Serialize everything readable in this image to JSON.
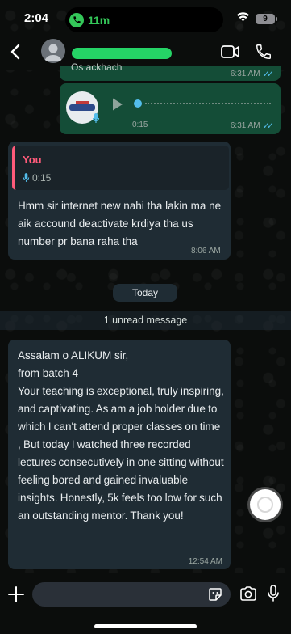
{
  "status_bar": {
    "time": "2:04",
    "call_duration": "11m",
    "battery": "9"
  },
  "header": {
    "contact_name": ""
  },
  "messages": {
    "outgoing_top": {
      "partial_text": "Os ackhach",
      "time": "6:31 AM"
    },
    "voice_note": {
      "duration": "0:15",
      "time": "6:31 AM"
    },
    "reply": {
      "quoted_author": "You",
      "quoted_duration": "0:15",
      "text": "Hmm sir internet new nahi tha lakin ma ne aik accound deactivate krdiya tha us number pr bana raha tha",
      "time": "8:06 AM"
    },
    "date_separator": "Today",
    "unread_banner": "1 unread message",
    "incoming": {
      "text_line1": "Assalam o ALIKUM sir,",
      "text_line2": "from batch 4",
      "text_body": "Your teaching is exceptional, truly inspiring, and captivating. As am a job holder due to which I can't attend proper classes on time , But today I watched three recorded lectures consecutively  in one sitting without feeling bored and gained invaluable insights. Honestly, 5k feels too low for such an outstanding mentor. Thank you!",
      "time": "12:54 AM"
    }
  },
  "input": {
    "placeholder": ""
  },
  "colors": {
    "outgoing_bubble": "#144d37",
    "incoming_bubble": "#1f2c34",
    "accent_green": "#25d366",
    "read_ticks": "#53bdeb",
    "quote_bar": "#ff5b7a"
  },
  "icons": [
    "back-chevron-icon",
    "video-call-icon",
    "phone-icon",
    "play-icon",
    "mic-icon",
    "plus-icon",
    "sticker-icon",
    "camera-icon",
    "wifi-icon",
    "phone-call-icon"
  ]
}
